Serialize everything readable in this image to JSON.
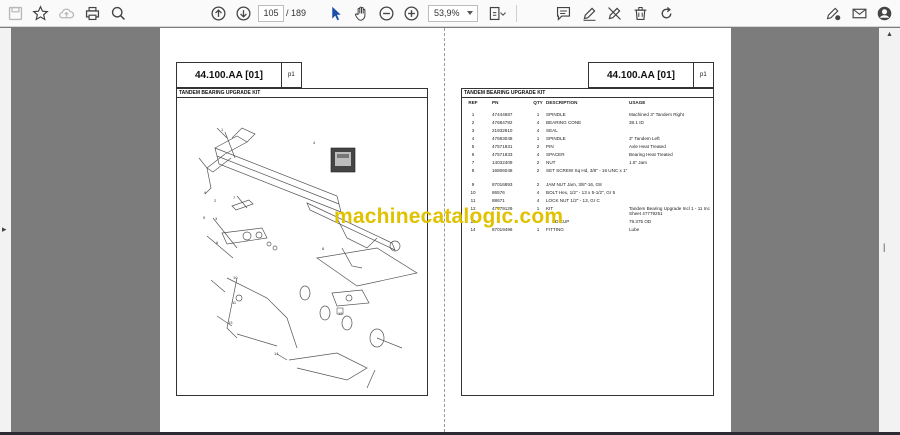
{
  "toolbar": {
    "current_page": "105",
    "total_pages": "/ 189",
    "zoom": "53,9%"
  },
  "page": {
    "left": {
      "title": "44.100.AA [01]",
      "page_ref": "p1",
      "section": "TANDEM BEARING UPGRADE KIT",
      "callouts": [
        "1",
        "2",
        "3",
        "4",
        "5",
        "6",
        "7",
        "8",
        "9",
        "10",
        "11",
        "12",
        "13",
        "14"
      ]
    },
    "right": {
      "title": "44.100.AA [01]",
      "page_ref": "p1",
      "section": "TANDEM BEARING UPGRADE KIT",
      "columns": {
        "ref": "REF",
        "pn": "PN",
        "qty": "QTY",
        "desc": "DESCRIPTION",
        "usage": "USAGE"
      },
      "rows": [
        {
          "ref": "1",
          "pn": "47444687",
          "qty": "1",
          "desc": "SPINDLE",
          "usage": "Machined 3\" Tandem Right"
        },
        {
          "ref": "2",
          "pn": "47684782",
          "qty": "4",
          "desc": "BEARING CONE",
          "usage": "38.1 ID"
        },
        {
          "ref": "3",
          "pn": "21932810",
          "qty": "4",
          "desc": "SEAL",
          "usage": ""
        },
        {
          "ref": "4",
          "pn": "47683048",
          "qty": "1",
          "desc": "SPINDLE",
          "usage": "3\" Tandem Left"
        },
        {
          "ref": "5",
          "pn": "47571831",
          "qty": "2",
          "desc": "PIN",
          "usage": "Axle Heat Treated"
        },
        {
          "ref": "6",
          "pn": "47571833",
          "qty": "4",
          "desc": "SPACER",
          "usage": "Bearing Heat Treated"
        },
        {
          "ref": "7",
          "pn": "14032409",
          "qty": "2",
          "desc": "NUT",
          "usage": "1.5\" Jam"
        },
        {
          "ref": "8",
          "pn": "16806048",
          "qty": "2",
          "desc": "SET SCREW Sq Hd, 3/8\" - 16 UNC x 1\"",
          "usage": ""
        },
        {
          "ref": "9",
          "pn": "87016893",
          "qty": "2",
          "desc": "JAM NUT Jam, 3/8\"-16, G8",
          "usage": ""
        },
        {
          "ref": "10",
          "pn": "86576",
          "qty": "4",
          "desc": "BOLT Hex, 1/2\" - 13 x 5-1/2\", Gr 5",
          "usage": ""
        },
        {
          "ref": "11",
          "pn": "88671",
          "qty": "4",
          "desc": "LOCK NUT 1/2\" - 13, Gr C",
          "usage": ""
        },
        {
          "ref": "12",
          "pn": "47779129",
          "qty": "1",
          "desc": "KIT",
          "usage": "Tandem Bearing Upgrade Incl 1 - 11 Inc Sheet 47779251"
        },
        {
          "ref": "13",
          "pn": "",
          "qty": "",
          "desc": "ED CUP",
          "usage": "79.375 OD"
        },
        {
          "ref": "14",
          "pn": "87019496",
          "qty": "1",
          "desc": "FITTING",
          "usage": "Lube"
        }
      ]
    }
  },
  "watermark": "machinecatalogic.com",
  "colors": {
    "watermark": "#e0c200",
    "workspace": "#7c7c7c",
    "toolbar": "#fafafa"
  }
}
